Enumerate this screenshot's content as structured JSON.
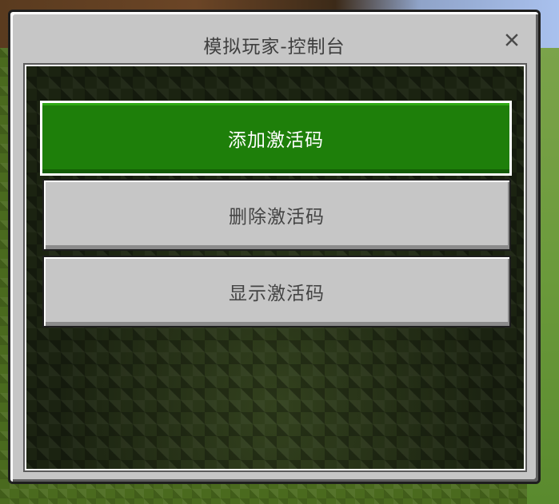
{
  "dialog": {
    "title": "模拟玩家-控制台",
    "close_icon": "close-icon"
  },
  "buttons": {
    "add_label": "添加激活码",
    "remove_label": "删除激活码",
    "show_label": "显示激活码"
  },
  "colors": {
    "panel": "#c6c6c6",
    "primary_button": "#1e7f0a",
    "primary_text": "#ffffff",
    "secondary_text": "#444444",
    "frame": "#1e1e1e"
  }
}
